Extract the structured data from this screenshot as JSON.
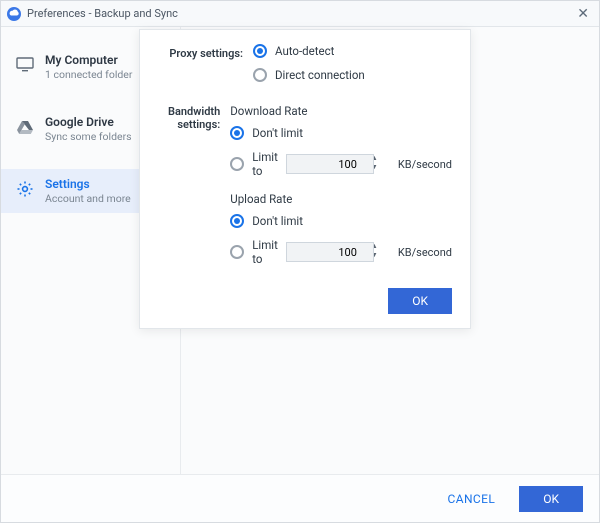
{
  "window": {
    "title": "Preferences - Backup and Sync"
  },
  "sidebar": {
    "items": [
      {
        "title": "My Computer",
        "subtitle": "1 connected folder"
      },
      {
        "title": "Google Drive",
        "subtitle": "Sync some folders"
      },
      {
        "title": "Settings",
        "subtitle": "Account and more"
      }
    ]
  },
  "dialog": {
    "proxy": {
      "label": "Proxy settings:",
      "auto_detect": "Auto-detect",
      "direct": "Direct connection"
    },
    "bandwidth": {
      "label": "Bandwidth settings:",
      "download": {
        "heading": "Download Rate",
        "dont_limit": "Don't limit",
        "limit_to": "Limit to",
        "value": "100",
        "unit": "KB/second"
      },
      "upload": {
        "heading": "Upload Rate",
        "dont_limit": "Don't limit",
        "limit_to": "Limit to",
        "value": "100",
        "unit": "KB/second"
      }
    },
    "ok": "OK"
  },
  "footer": {
    "cancel": "CANCEL",
    "ok": "OK"
  }
}
